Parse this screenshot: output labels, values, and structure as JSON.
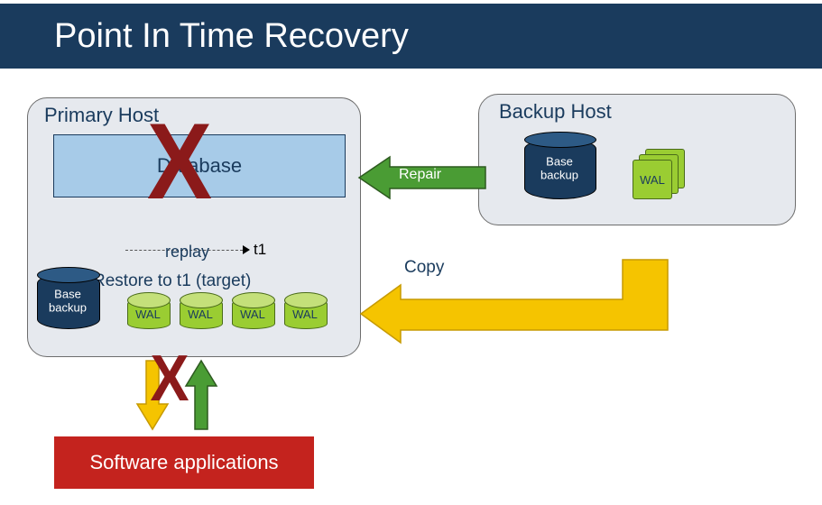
{
  "title": "Point In Time Recovery",
  "primary": {
    "title": "Primary Host",
    "database": "Database",
    "replay": "replay",
    "t1": "t1",
    "restore": "Restore to t1 (target)",
    "base": "Base\nbackup",
    "wal": [
      "WAL",
      "WAL",
      "WAL",
      "WAL"
    ]
  },
  "backup": {
    "title": "Backup Host",
    "base": "Base\nbackup",
    "wal": "WAL"
  },
  "arrows": {
    "repair": "Repair",
    "copy": "Copy"
  },
  "software": "Software applications"
}
